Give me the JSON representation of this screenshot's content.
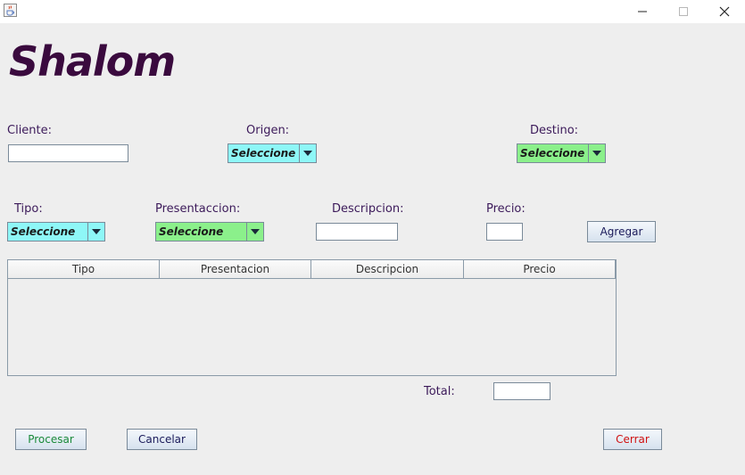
{
  "window": {
    "app_icon": "java-cup-icon",
    "controls": [
      "minimize",
      "maximize",
      "close"
    ]
  },
  "logo": "Shalom",
  "form": {
    "cliente": {
      "label": "Cliente:",
      "value": ""
    },
    "origen": {
      "label": "Origen:",
      "value": "Seleccione",
      "color": "#8ef7f7"
    },
    "destino": {
      "label": "Destino:",
      "value": "Seleccione",
      "color": "#8bf08b"
    },
    "tipo": {
      "label": "Tipo:",
      "value": "Seleccione",
      "color": "#8ef7f7"
    },
    "presentacion": {
      "label": "Presentaccion:",
      "value": "Seleccione",
      "color": "#8bf08b"
    },
    "descripcion": {
      "label": "Descripcion:",
      "value": ""
    },
    "precio": {
      "label": "Precio:",
      "value": ""
    },
    "agregar_label": "Agregar"
  },
  "table": {
    "columns": [
      "Tipo",
      "Presentacion",
      "Descripcion",
      "Precio"
    ],
    "rows": []
  },
  "total": {
    "label": "Total:",
    "value": ""
  },
  "buttons": {
    "procesar": {
      "label": "Procesar",
      "color": "#1a8a3a"
    },
    "cancelar": {
      "label": "Cancelar",
      "color": "#1a1a5a"
    },
    "cerrar": {
      "label": "Cerrar",
      "color": "#d01010"
    }
  }
}
